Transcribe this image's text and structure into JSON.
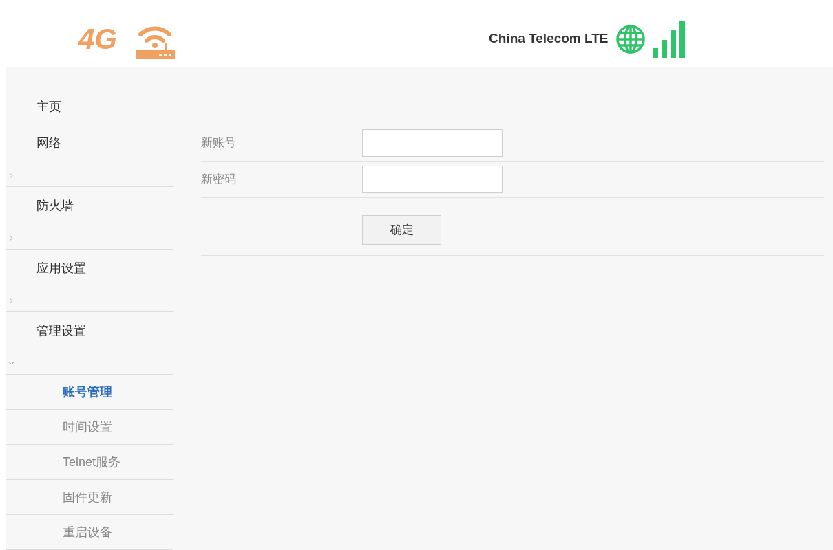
{
  "header": {
    "logo": "4G",
    "carrier": "China Telecom LTE"
  },
  "sidebar": {
    "items": [
      {
        "label": "主页",
        "kind": "link"
      },
      {
        "label": "网络",
        "kind": "group",
        "expanded": false
      },
      {
        "label": "防火墙",
        "kind": "group",
        "expanded": false
      },
      {
        "label": "应用设置",
        "kind": "group",
        "expanded": false
      },
      {
        "label": "管理设置",
        "kind": "group",
        "expanded": true,
        "children": [
          {
            "label": "账号管理",
            "selected": true
          },
          {
            "label": "时间设置",
            "selected": false
          },
          {
            "label": "Telnet服务",
            "selected": false
          },
          {
            "label": "固件更新",
            "selected": false
          },
          {
            "label": "重启设备",
            "selected": false
          }
        ]
      }
    ]
  },
  "form": {
    "fields": [
      {
        "label": "新账号"
      },
      {
        "label": "新密码"
      }
    ],
    "submit": "确定"
  }
}
